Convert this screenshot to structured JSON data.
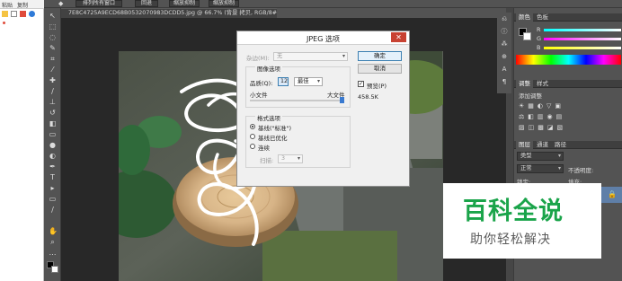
{
  "left_window": {
    "menu": [
      "粘贴",
      "复制"
    ]
  },
  "options_bar": {
    "buttons": [
      "排列所有窗口",
      "回退",
      "缩放抑制",
      "缩放抑制"
    ]
  },
  "document": {
    "tab_title": "7E8C4725A9ECD68B0532070983DCDD5.jpg @ 66.7% (背景 拷贝, RGB/8#) *",
    "zoom_percent": 66.7
  },
  "dialog": {
    "title": "JPEG 选项",
    "close_label": "✕",
    "matte_label": "杂边(M):",
    "matte_value": "无",
    "image_options_label": "图像选项",
    "quality_label": "品质(Q):",
    "quality_value": "12",
    "quality_preset": "最佳",
    "small_file_label": "小文件",
    "large_file_label": "大文件",
    "quality_slider_fraction": 1.0,
    "format_options_label": "格式选项",
    "format_options": [
      "基线(\"标准\")",
      "基线已优化",
      "连续"
    ],
    "format_selected_index": 0,
    "scans_label": "扫描:",
    "scans_value": "3",
    "ok_label": "确定",
    "cancel_label": "取消",
    "preview_label": "预览(P)",
    "preview_checked": true,
    "file_size": "458.5K"
  },
  "right_panel": {
    "tabs_top": [
      "颜色",
      "色板"
    ],
    "channel_labels": [
      "R",
      "G",
      "B"
    ],
    "tabs_mid": [
      "调整",
      "样式"
    ],
    "adjust_label": "添加调整",
    "tabs_layers": [
      "图层",
      "通道",
      "路径"
    ],
    "kind_label": "类型",
    "blend_mode": "正常",
    "opacity_label": "不透明度:",
    "lock_label": "锁定:",
    "fill_label": "填充:"
  },
  "watermark": {
    "brand": "百科全说",
    "tagline": "助你轻松解决"
  },
  "icons": [
    "move-icon",
    "marquee-icon",
    "lasso-icon",
    "quick-select-icon",
    "crop-icon",
    "eyedropper-icon",
    "healing-icon",
    "brush-icon",
    "stamp-icon",
    "history-brush-icon",
    "eraser-icon",
    "gradient-icon",
    "blur-icon",
    "dodge-icon",
    "pen-icon",
    "type-icon",
    "path-select-icon",
    "shape-icon",
    "hand-icon",
    "zoom-icon"
  ],
  "colors": {
    "accent_close": "#c84232",
    "watermark_green": "#1aa44a"
  }
}
